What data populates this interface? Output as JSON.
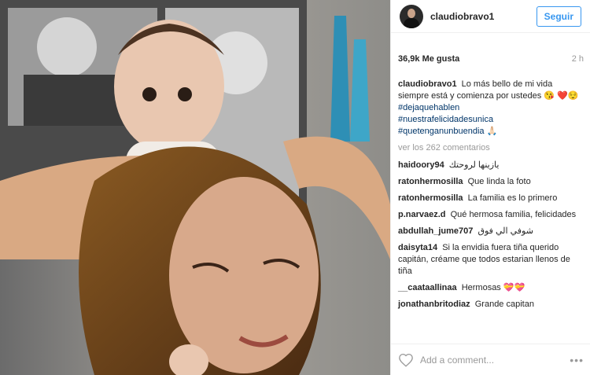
{
  "header": {
    "username": "claudiobravo1",
    "follow_label": "Seguir"
  },
  "meta": {
    "likes": "36,9k Me gusta",
    "time": "2 h"
  },
  "caption": {
    "username": "claudiobravo1",
    "text": "Lo más bello de mi vida siempre está y comienza por ustedes 😘 ❤️😌",
    "hashtags": [
      "#dejaquehablen",
      "#nuestrafelicidadesunica",
      "#quetenganunbuendia 🙏🏻"
    ]
  },
  "view_all": "ver los 262 comentarios",
  "comments": [
    {
      "user": "haidoory94",
      "text": "يازينها لروحتك"
    },
    {
      "user": "ratonhermosilla",
      "text": "Que linda la foto"
    },
    {
      "user": "ratonhermosilla",
      "text": "La familia es lo primero"
    },
    {
      "user": "p.narvaez.d",
      "text": "Qué hermosa familia, felicidades"
    },
    {
      "user": "abdullah_jume707",
      "text": "شوفي الي فوق"
    },
    {
      "user": "daisyta14",
      "text": "Si la envidia fuera tiña querido capitán, créame que todos estarian llenos de tiña"
    },
    {
      "user": "__caataallinaa",
      "text": "Hermosas 💝💝"
    },
    {
      "user": "jonathanbritodiaz",
      "text": "Grande capitan"
    }
  ],
  "footer": {
    "placeholder": "Add a comment...",
    "more": "•••"
  }
}
